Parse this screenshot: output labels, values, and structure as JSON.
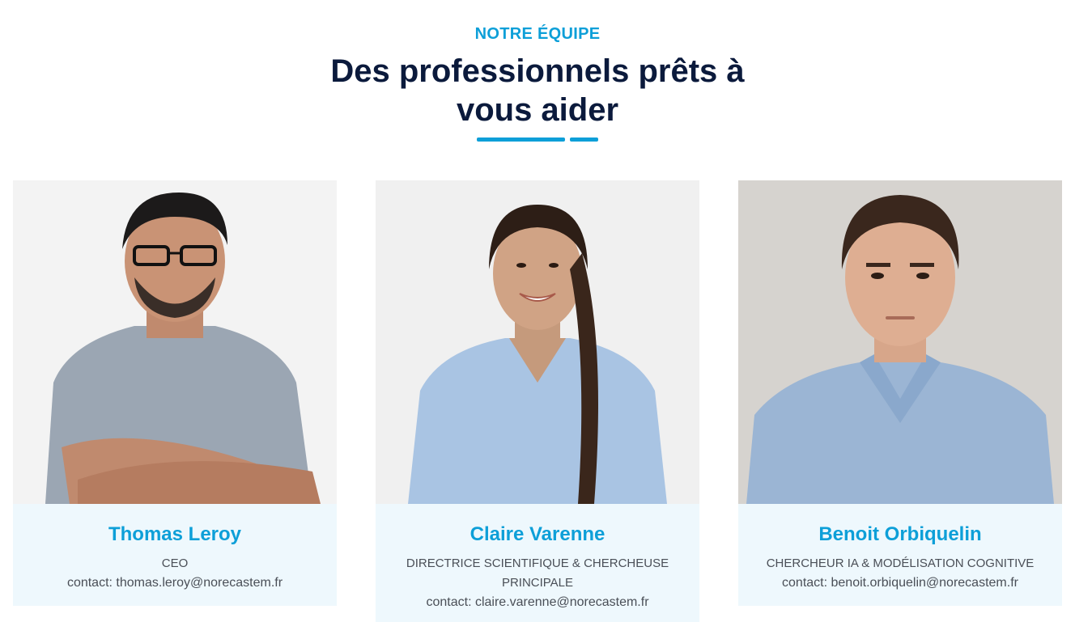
{
  "section": {
    "eyebrow": "NOTRE ÉQUIPE",
    "title": "Des professionnels prêts à vous aider"
  },
  "team": [
    {
      "name": "Thomas Leroy",
      "role": "CEO",
      "contact": "contact: thomas.leroy@norecastem.fr"
    },
    {
      "name": "Claire Varenne",
      "role": "DIRECTRICE SCIENTIFIQUE & CHERCHEUSE PRINCIPALE",
      "contact": "contact: claire.varenne@norecastem.fr"
    },
    {
      "name": "Benoit Orbiquelin",
      "role": "CHERCHEUR IA & MODÉLISATION COGNITIVE",
      "contact": "contact: benoit.orbiquelin@norecastem.fr"
    }
  ],
  "colors": {
    "accent": "#0d9fd8",
    "heading": "#0b1a3c",
    "card_bg": "#eef8fd",
    "text": "#4a4f57"
  }
}
